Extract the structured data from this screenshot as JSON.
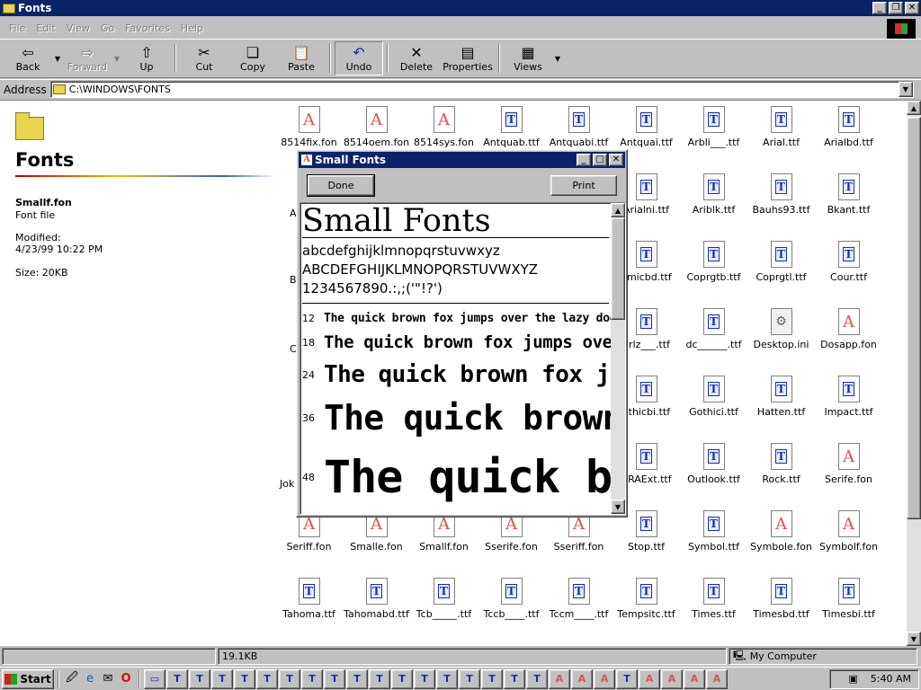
{
  "window": {
    "title": "Fonts"
  },
  "menu": [
    "File",
    "Edit",
    "View",
    "Go",
    "Favorites",
    "Help"
  ],
  "toolbar": {
    "back": "Back",
    "forward": "Forward",
    "up": "Up",
    "cut": "Cut",
    "copy": "Copy",
    "paste": "Paste",
    "undo": "Undo",
    "delete": "Delete",
    "properties": "Properties",
    "views": "Views"
  },
  "address": {
    "label": "Address",
    "value": "C:\\WINDOWS\\FONTS"
  },
  "left_pane": {
    "title": "Fonts",
    "file_name": "Smallf.fon",
    "file_type": "Font file",
    "modified_label": "Modified:",
    "modified_value": "4/23/99 10:22 PM",
    "size": "Size: 20KB"
  },
  "files": [
    {
      "name": "8514fix.fon",
      "kind": "a"
    },
    {
      "name": "8514oem.fon",
      "kind": "a"
    },
    {
      "name": "8514sys.fon",
      "kind": "a"
    },
    {
      "name": "Antquab.ttf",
      "kind": "t"
    },
    {
      "name": "Antquabi.ttf",
      "kind": "t"
    },
    {
      "name": "Antquai.ttf",
      "kind": "t"
    },
    {
      "name": "Arbli___.ttf",
      "kind": "t"
    },
    {
      "name": "Arial.ttf",
      "kind": "t"
    },
    {
      "name": "Arialbd.ttf",
      "kind": "t"
    },
    {
      "name": "Arialni.ttf",
      "kind": "t"
    },
    {
      "name": "Ariblk.ttf",
      "kind": "t"
    },
    {
      "name": "Bauhs93.ttf",
      "kind": "t"
    },
    {
      "name": "Bkant.ttf",
      "kind": "t"
    },
    {
      "name": "omicbd.ttf",
      "kind": "t"
    },
    {
      "name": "Coprgtb.ttf",
      "kind": "t"
    },
    {
      "name": "Coprgtl.ttf",
      "kind": "t"
    },
    {
      "name": "Cour.ttf",
      "kind": "t"
    },
    {
      "name": "urlz___.ttf",
      "kind": "t"
    },
    {
      "name": "dc______.ttf",
      "kind": "t"
    },
    {
      "name": "Desktop.ini",
      "kind": "ini"
    },
    {
      "name": "Dosapp.fon",
      "kind": "a"
    },
    {
      "name": "othicbi.ttf",
      "kind": "t"
    },
    {
      "name": "Gothici.ttf",
      "kind": "t"
    },
    {
      "name": "Hatten.ttf",
      "kind": "t"
    },
    {
      "name": "Impact.ttf",
      "kind": "t"
    },
    {
      "name": "CRAExt.ttf",
      "kind": "t"
    },
    {
      "name": "Outlook.ttf",
      "kind": "t"
    },
    {
      "name": "Rock.ttf",
      "kind": "t"
    },
    {
      "name": "Serife.fon",
      "kind": "a"
    },
    {
      "name": "Seriff.fon",
      "kind": "a"
    },
    {
      "name": "Smalle.fon",
      "kind": "a"
    },
    {
      "name": "Smallf.fon",
      "kind": "a"
    },
    {
      "name": "Sserife.fon",
      "kind": "a"
    },
    {
      "name": "Sseriff.fon",
      "kind": "a"
    },
    {
      "name": "Stop.ttf",
      "kind": "t"
    },
    {
      "name": "Symbol.ttf",
      "kind": "t"
    },
    {
      "name": "Symbole.fon",
      "kind": "a"
    },
    {
      "name": "Symbolf.fon",
      "kind": "a"
    },
    {
      "name": "Tahoma.ttf",
      "kind": "t"
    },
    {
      "name": "Tahomabd.ttf",
      "kind": "t"
    },
    {
      "name": "Tcb_____.ttf",
      "kind": "t"
    },
    {
      "name": "Tccb____.ttf",
      "kind": "t"
    },
    {
      "name": "Tccm____.ttf",
      "kind": "t"
    },
    {
      "name": "Tempsitc.ttf",
      "kind": "t"
    },
    {
      "name": "Times.ttf",
      "kind": "t"
    },
    {
      "name": "Timesbd.ttf",
      "kind": "t"
    },
    {
      "name": "Timesbi.ttf",
      "kind": "t"
    },
    {
      "name": "A",
      "kind": "cut"
    },
    {
      "name": "Be",
      "kind": "cut"
    },
    {
      "name": "C",
      "kind": "cut"
    },
    {
      "name": "Jok",
      "kind": "cut"
    }
  ],
  "dialog": {
    "title": "Small Fonts",
    "done": "Done",
    "print": "Print",
    "font_name": "Small Fonts",
    "lower": "abcdefghijklmnopqrstuvwxyz",
    "upper": "ABCDEFGHIJKLMNOPQRSTUVWXYZ",
    "digits": "1234567890.:,;('\"!?')",
    "samples": [
      {
        "size": "12",
        "text": "The quick brown fox jumps over the lazy dog"
      },
      {
        "size": "18",
        "text": "The quick brown fox jumps over"
      },
      {
        "size": "24",
        "text": "The quick brown fox jumps"
      },
      {
        "size": "36",
        "text": "The quick brown"
      },
      {
        "size": "48",
        "text": "The quick brown"
      }
    ]
  },
  "status": {
    "size": "19.1KB",
    "location": "My Computer"
  },
  "taskbar": {
    "start": "Start",
    "clock": "5:40 AM"
  }
}
